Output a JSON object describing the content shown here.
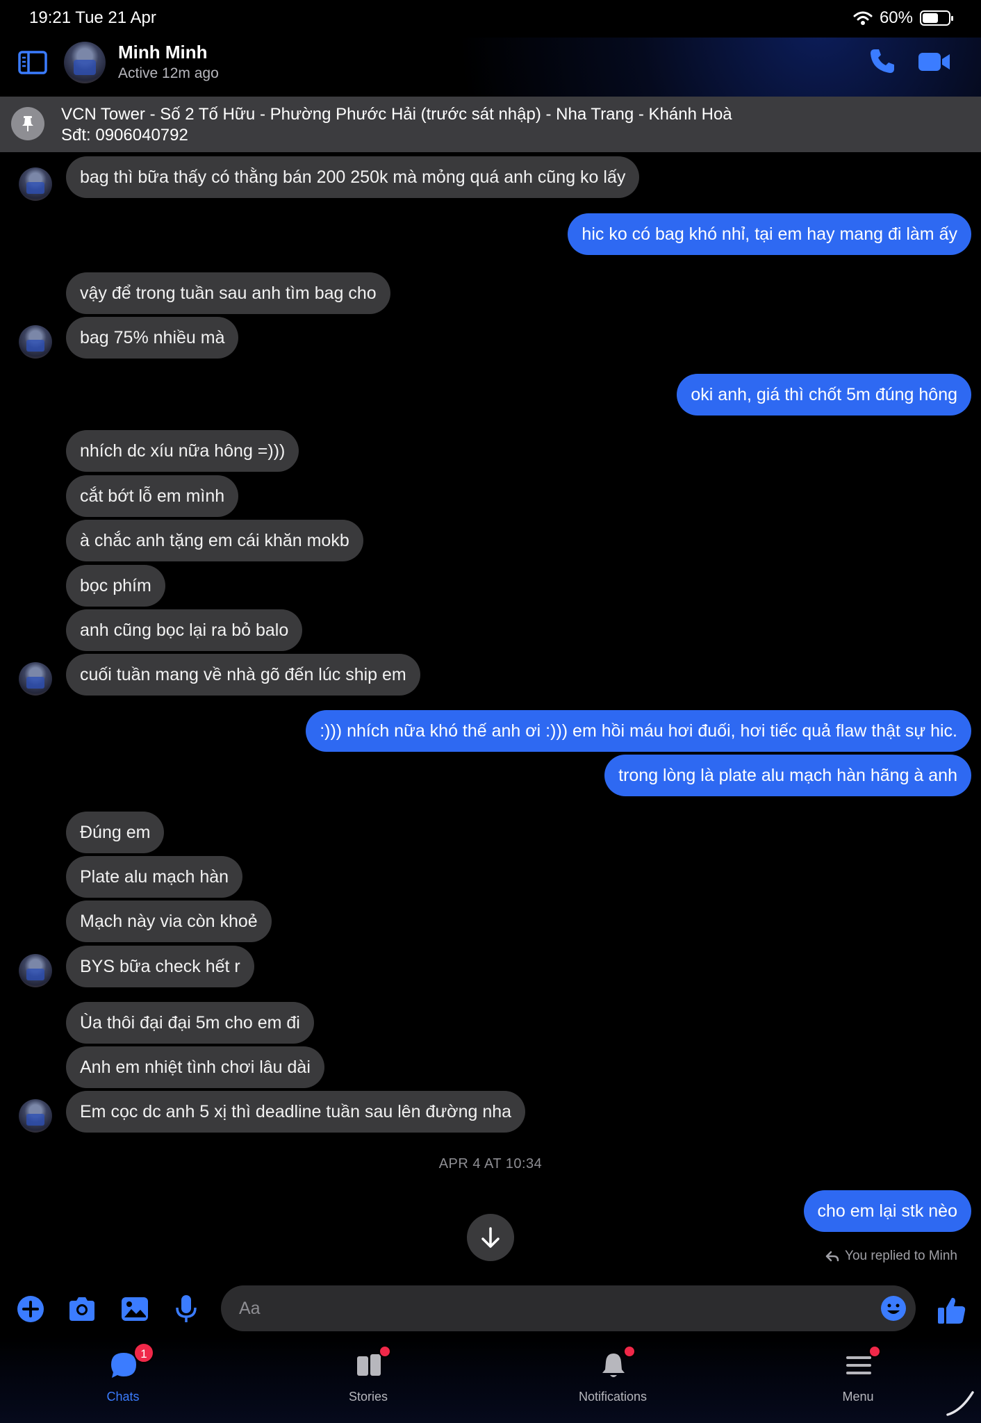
{
  "status_bar": {
    "time": "19:21   Tue 21 Apr",
    "battery": "60%",
    "battery_level": 0.6
  },
  "header": {
    "contact_name": "Minh Minh",
    "contact_status": "Active 12m ago"
  },
  "pinned": {
    "line1": "VCN Tower - Số 2 Tố Hữu - Phường Phước Hải (trước sát nhập) - Nha Trang - Khánh Hoà",
    "line2": "Sđt: 0906040792"
  },
  "messages": [
    {
      "side": "in",
      "text": "bag thì bữa thấy có thằng bán 200 250k mà mỏng quá anh cũng ko lấy"
    },
    {
      "side": "out",
      "text": "hic ko có bag khó nhỉ, tại em hay mang đi làm ấy"
    },
    {
      "side": "in",
      "text": "vậy để trong tuần sau anh tìm bag cho"
    },
    {
      "side": "in",
      "text": "bag 75% nhiều mà"
    },
    {
      "side": "out",
      "text": "oki anh, giá thì chốt 5m đúng hông"
    },
    {
      "side": "in",
      "text": "nhích dc xíu nữa hông =)))"
    },
    {
      "side": "in",
      "text": "cắt bớt lỗ em mình"
    },
    {
      "side": "in",
      "text": "à chắc anh tặng em cái khăn mokb"
    },
    {
      "side": "in",
      "text": "bọc phím"
    },
    {
      "side": "in",
      "text": "anh cũng bọc lại ra bỏ balo"
    },
    {
      "side": "in",
      "text": "cuối tuần mang về nhà gõ đến lúc ship em"
    },
    {
      "side": "out",
      "text": ":))) nhích nữa khó thế anh ơi :))) em hồi máu hơi đuối, hơi tiếc quả flaw thật sự hic."
    },
    {
      "side": "out",
      "text": "trong lòng là plate alu mạch hàn hãng à anh"
    },
    {
      "side": "in",
      "text": "Đúng em"
    },
    {
      "side": "in",
      "text": "Plate alu mạch hàn"
    },
    {
      "side": "in",
      "text": "Mạch này via còn khoẻ"
    },
    {
      "side": "in",
      "text": "BYS bữa check hết r"
    },
    {
      "side": "in",
      "text": "Ùa thôi đại đại 5m cho em đi"
    },
    {
      "side": "in",
      "text": "Anh em nhiệt tình chơi lâu dài"
    },
    {
      "side": "in",
      "text": "Em cọc dc anh 5 xị thì deadline tuần sau lên đường nha"
    },
    {
      "side": "out",
      "text": "cho em lại stk nèo"
    }
  ],
  "timestamp": "APR 4 AT 10:34",
  "reply_note": "You replied to Minh",
  "composer": {
    "placeholder": "Aa"
  },
  "tabs": [
    {
      "label": "Chats",
      "icon": "chat-bubble-icon",
      "badge": "1"
    },
    {
      "label": "Stories",
      "icon": "stories-icon"
    },
    {
      "label": "Notifications",
      "icon": "bell-icon"
    },
    {
      "label": "Menu",
      "icon": "hamburger-menu-icon"
    }
  ],
  "colors": {
    "accent": "#2e69f2",
    "incoming_bubble": "#3a3a3c",
    "badge": "#f02849",
    "icon_blue": "#3b7cff"
  }
}
